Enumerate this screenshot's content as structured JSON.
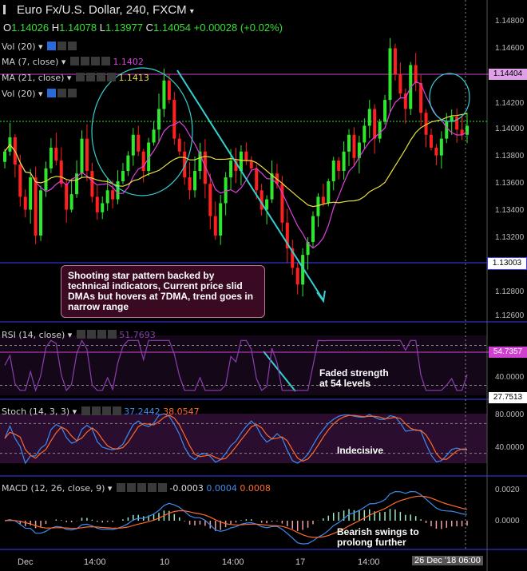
{
  "header": {
    "title": "Euro Fx/U.S. Dollar, 240, FXCM",
    "ohlc": [
      {
        "k": "O",
        "v": "1.14026"
      },
      {
        "k": "H",
        "v": "1.14078"
      },
      {
        "k": "L",
        "v": "1.13977"
      },
      {
        "k": "C",
        "v": "1.14054"
      },
      {
        "k": "",
        "v": "+0.00028 (+0.02%)"
      }
    ]
  },
  "indicators": {
    "vol1": "Vol (20)",
    "ma7": "MA (7, close)",
    "ma7_val": "1.1402",
    "ma21": "MA (21, close)",
    "ma21_val": "1.1413",
    "vol2": "Vol (20)",
    "rsi": "RSI (14, close)",
    "rsi_val": "51.7693",
    "stoch": "Stoch (14, 3, 3)",
    "stoch_k": "37.2442",
    "stoch_d": "38.0547",
    "macd": "MACD (12, 26, close, 9)",
    "macd_hist": "-0.0003",
    "macd_line": "0.0004",
    "macd_signal": "0.0008"
  },
  "annotations": {
    "main": "Shooting star pattern backed by technical indicators, Current price slid DMAs but hovers at 7DMA, trend goes in narrow range",
    "rsi": "Faded strength at 54 levels",
    "stoch": "Indecisive",
    "macd": "Bearish swings to prolong further"
  },
  "price_axis": [
    "1.14800",
    "1.14600",
    "1.14200",
    "1.14000",
    "1.13800",
    "1.13600",
    "1.13400",
    "1.13200",
    "1.12800",
    "1.12600"
  ],
  "price_tags": {
    "resistance": "1.14404",
    "support": "1.13003"
  },
  "rsi_axis": {
    "tick": "40.0000",
    "tag_high": "54.7357",
    "tag_low": "27.7513"
  },
  "stoch_axis": [
    "80.0000",
    "40.0000"
  ],
  "macd_axis": [
    "0.0020",
    "0.0000"
  ],
  "x_axis": [
    "Dec",
    "14:00",
    "10",
    "14:00",
    "17",
    "14:00"
  ],
  "cursor_date": "26 Dec '18",
  "cursor_time": "06:00",
  "colors": {
    "up": "#2ee82e",
    "down": "#ff2020",
    "ma7": "#e040e0",
    "ma21": "#e8e040",
    "rsi": "#8a3fb0",
    "stoch_k": "#3b8cf0",
    "stoch_d": "#ff6a2a",
    "hline": "#3b3bff",
    "tagline": "#d040d0"
  },
  "chart_data": {
    "type": "candlestick",
    "timeframe": "240",
    "close_series": [
      1.1385,
      1.1396,
      1.1375,
      1.135,
      1.134,
      1.1365,
      1.132,
      1.1355,
      1.1372,
      1.1388,
      1.1378,
      1.136,
      1.134,
      1.1352,
      1.1368,
      1.1395,
      1.137,
      1.135,
      1.1338,
      1.1345,
      1.1355,
      1.1348,
      1.1362,
      1.137,
      1.1382,
      1.1398,
      1.1385,
      1.137,
      1.1392,
      1.1402,
      1.1418,
      1.144,
      1.1425,
      1.1395,
      1.1385,
      1.1365,
      1.1355,
      1.137,
      1.1385,
      1.136,
      1.1335,
      1.132,
      1.1345,
      1.1365,
      1.1378,
      1.137,
      1.1385,
      1.1378,
      1.1372,
      1.1355,
      1.134,
      1.1348,
      1.1368,
      1.136,
      1.133,
      1.131,
      1.1295,
      1.1282,
      1.1305,
      1.1315,
      1.1335,
      1.135,
      1.1345,
      1.1362,
      1.1378,
      1.137,
      1.1385,
      1.1398,
      1.138,
      1.1392,
      1.1405,
      1.1418,
      1.1395,
      1.1408,
      1.1425,
      1.1465,
      1.1445,
      1.143,
      1.1418,
      1.1452,
      1.1438,
      1.1415,
      1.1398,
      1.1388,
      1.1382,
      1.1395,
      1.1408,
      1.1412,
      1.1402,
      1.1398,
      1.1405
    ],
    "ma7_value": 1.1402,
    "ma21_value": 1.1413,
    "resistance": 1.14404,
    "support": 1.13003,
    "rsi_value": 51.7693,
    "stoch_k": 37.2442,
    "stoch_d": 38.0547,
    "macd": {
      "histogram": -0.0003,
      "macd": 0.0004,
      "signal": 0.0008
    }
  }
}
